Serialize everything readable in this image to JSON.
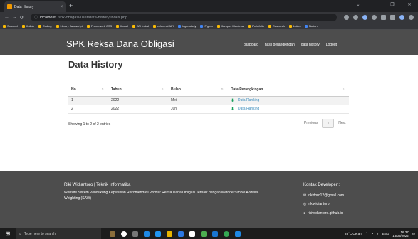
{
  "browser": {
    "tab_title": "Data History",
    "tab_close": "×",
    "new_tab": "+",
    "url_host": "localhost",
    "url_path": "/spk-obligasi/user/data-history/index.php",
    "window_controls": [
      "⌄",
      "—",
      "❐",
      "✕"
    ],
    "bookmarks": [
      "Sosmed",
      "Kuliah",
      "Coding",
      "Library Javascript",
      "Framework CSS",
      "Ikonal",
      "API Lokal",
      "referensi API",
      "hyperstudy",
      "Figma",
      "Kampus Merdeka",
      "Portofolio",
      "Research",
      "Loker",
      "Notion"
    ]
  },
  "header": {
    "brand": "SPK Reksa Dana Obligasi",
    "nav": [
      "dasboard",
      "hasil perangkingan",
      "data history",
      "Logout"
    ]
  },
  "page": {
    "title": "Data History"
  },
  "table": {
    "headers": [
      "No",
      "Tahun",
      "Bulan",
      "Data Perangkingan"
    ],
    "rows": [
      {
        "no": "1",
        "tahun": "2022",
        "bulan": "Mei",
        "link": "Data Ranking"
      },
      {
        "no": "2",
        "tahun": "2022",
        "bulan": "Juni",
        "link": "Data Ranking"
      }
    ]
  },
  "pagination": {
    "info": "Showing 1 to 2 of 2 entries",
    "previous": "Previous",
    "current": "1",
    "next": "Next"
  },
  "footer": {
    "title": "Riki Widiantoro | Teknik Informatika",
    "description": "Website Sistem Pendukung Keputusan Rekomendasi Produk Reksa Dana Obligasi Terbaik dengan Metode Simple Additive Weighting (SAW)",
    "contact_title": "Kontak Developer :",
    "email": "rikidoro12@gmail.com",
    "instagram": "rikiwidiantoro",
    "github": "rikiwidiantoro.github.io"
  },
  "taskbar": {
    "search_placeholder": "Type here to search",
    "weather": "29°C  Cerah",
    "lang": "ENG",
    "time": "16.37",
    "date": "15/06/2022"
  },
  "colors": {
    "header_bg": "#4d4d4d",
    "footer_bg": "#4d4d4d",
    "link": "#3c8dbc",
    "download_icon": "#17a05d"
  }
}
